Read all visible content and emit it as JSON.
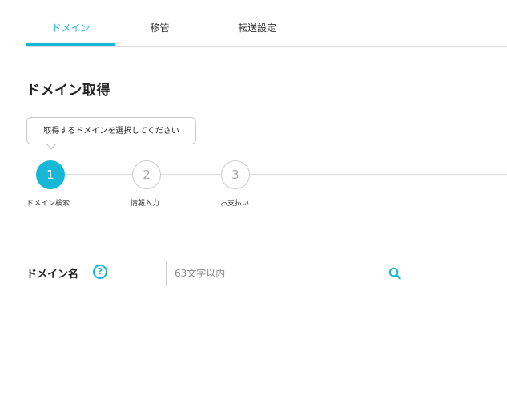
{
  "tabs": [
    {
      "label": "ドメイン",
      "active": true
    },
    {
      "label": "移管",
      "active": false
    },
    {
      "label": "転送設定",
      "active": false
    }
  ],
  "page_title": "ドメイン取得",
  "tooltip": "取得するドメインを選択してください",
  "steps": [
    {
      "number": "1",
      "label": "ドメイン検索",
      "active": true
    },
    {
      "number": "2",
      "label": "情報入力",
      "active": false
    },
    {
      "number": "3",
      "label": "お支払い",
      "active": false
    }
  ],
  "domain_field": {
    "label": "ドメイン名",
    "help_symbol": "?",
    "placeholder": "63文字以内",
    "value": ""
  },
  "colors": {
    "accent": "#16b8d6",
    "border": "#cccccc"
  },
  "icons": {
    "search": "search-icon",
    "help": "question-circle-icon"
  }
}
